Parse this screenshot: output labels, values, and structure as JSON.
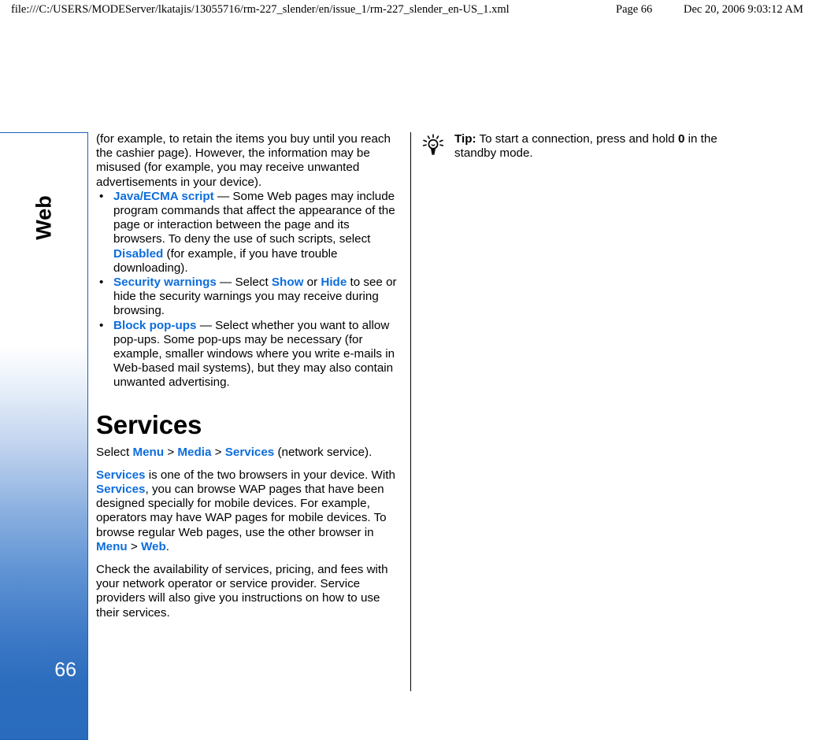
{
  "print_header": {
    "url": "file:///C:/USERS/MODEServer/lkatajis/13055716/rm-227_slender/en/issue_1/rm-227_slender_en-US_1.xml",
    "page": "Page 66",
    "date": "Dec 20, 2006 9:03:12 AM"
  },
  "side_tab": {
    "label": "Web",
    "page_number": "66",
    "border_color": "#1964ba",
    "gradient_bottom_color": "#2a6bbd"
  },
  "colors": {
    "link": "#0d6ddc",
    "text": "#000000",
    "page_number_text": "#ffffff"
  },
  "left_column": {
    "continued_paragraph": "(for example, to retain the items you buy until you reach the cashier page). However, the information may be misused (for example, you may receive unwanted advertisements in your device).",
    "bullets": [
      {
        "marker": "•",
        "term": "Java/ECMA script",
        "dash": " — ",
        "text_part_1": "Some Web pages may include program commands that affect the appearance of the page or interaction between the page and its browsers. To deny the use of such scripts, select ",
        "inline_link_1": "Disabled",
        "text_part_2": " (for example, if you have trouble downloading)."
      },
      {
        "marker": "•",
        "term": "Security warnings",
        "dash": " — ",
        "text_part_1": "Select ",
        "inline_link_1": "Show",
        "text_part_2": " or ",
        "inline_link_2": "Hide",
        "text_part_3": " to see or hide the security warnings you may receive during browsing."
      },
      {
        "marker": "•",
        "term": "Block pop-ups",
        "dash": " — ",
        "text_part_1": "Select whether you want to allow pop-ups. Some pop-ups may be necessary (for example, smaller windows where you write e-mails in Web-based mail systems), but they may also contain unwanted advertising."
      }
    ],
    "heading": "Services",
    "select_path": {
      "prefix": "Select ",
      "item_1": "Menu",
      "sep_1": " > ",
      "item_2": "Media",
      "sep_2": " > ",
      "item_3": "Services",
      "suffix": " (network service)."
    },
    "paragraph_2": {
      "link_1": "Services",
      "text_1": " is one of the two browsers in your device. With ",
      "link_2": "Services",
      "text_2": ", you can browse WAP pages that have been designed specially for mobile devices. For example, operators may have WAP pages for mobile devices. To browse regular Web pages, use the other browser in ",
      "link_3": "Menu",
      "text_3": " > ",
      "link_4": "Web",
      "text_4": "."
    },
    "paragraph_3": "Check the availability of services, pricing, and fees with your network operator or service provider. Service providers will also give you instructions on how to use their services."
  },
  "right_column": {
    "tip": {
      "icon": "lightbulb-icon",
      "label": "Tip:",
      "text_1": " To start a connection, press and hold ",
      "key": "0",
      "text_2": " in the standby mode."
    }
  }
}
